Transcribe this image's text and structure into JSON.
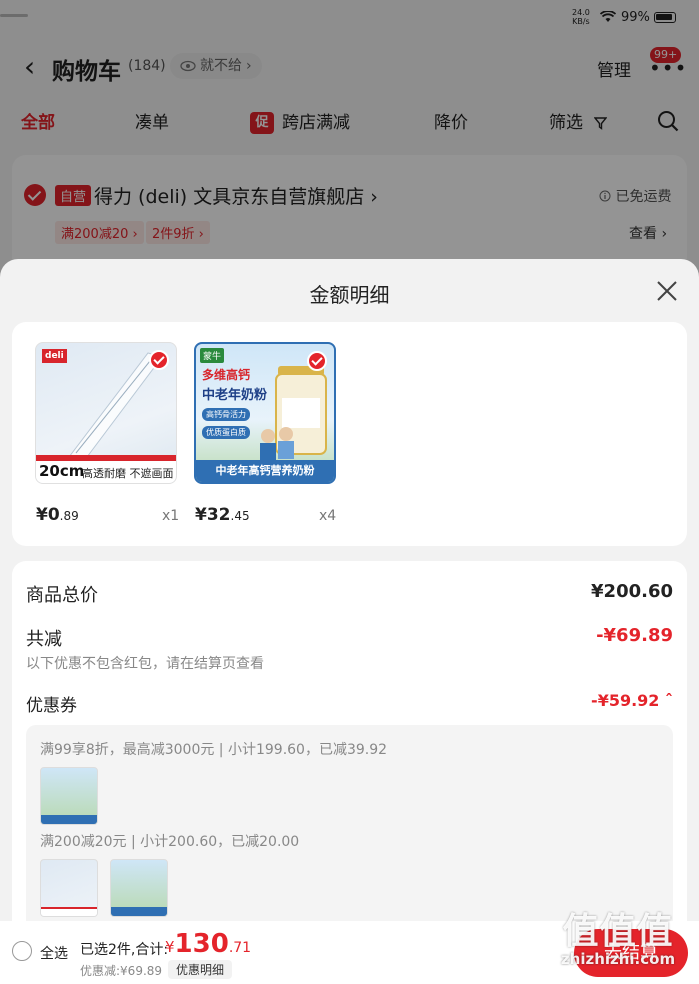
{
  "status_bar": {
    "speed_value": "24.0",
    "speed_unit": "KB/s",
    "battery": "99%"
  },
  "header": {
    "title": "购物车",
    "count": "(184)",
    "privacy_label": "就不给",
    "manage_label": "管理",
    "badge": "99+"
  },
  "tabs": [
    {
      "label": "全部"
    },
    {
      "label": "凑单"
    },
    {
      "label": "跨店满减",
      "icon_text": "促"
    },
    {
      "label": "降价"
    },
    {
      "label": "筛选"
    }
  ],
  "store": {
    "self_tag": "自营",
    "name": "得力 (deli) 文具京东自营旗舰店 ›",
    "shipping": "已免运费",
    "promos": [
      "满200减20 ›",
      "2件9折 ›"
    ],
    "view_label": "查看 ›"
  },
  "sheet": {
    "title": "金额明细",
    "products": [
      {
        "price_int": "¥0",
        "price_dec": ".89",
        "qty": "x1",
        "brand": "deli",
        "badge_text": "20cm",
        "caption": "高透耐磨 不遮画面"
      },
      {
        "price_int": "¥32",
        "price_dec": ".45",
        "qty": "x4",
        "brand": "蒙牛",
        "headline1": "多维高钙",
        "headline2": "中老年奶粉",
        "tag1": "高钙骨活力",
        "tag2": "优质蛋白质",
        "banner": "中老年高钙营养奶粉"
      }
    ],
    "total_label": "商品总价",
    "total_value": "¥200.60",
    "reduce_label": "共减",
    "reduce_value": "-¥69.89",
    "reduce_note": "以下优惠不包含红包，请在结算页查看",
    "coupon_label": "优惠券",
    "coupon_value": "-¥59.92 ˆ",
    "coupon_lines": [
      "满99享8折，最高减3000元 | 小计199.60，已减39.92",
      "满200减20元 | 小计200.60，已减20.00"
    ]
  },
  "bottom": {
    "select_all": "全选",
    "selected": "已选2件,合计:",
    "currency": "¥",
    "total_int": "130",
    "total_dec": ".71",
    "discount": "优惠减:¥69.89",
    "detail_btn": "优惠明细",
    "checkout": "去结算"
  },
  "watermark": {
    "glyphs": "值值值",
    "url": "zhizhizhi.com"
  },
  "colors": {
    "accent": "#e4242b",
    "dark": "#222222",
    "muted": "#888888"
  }
}
